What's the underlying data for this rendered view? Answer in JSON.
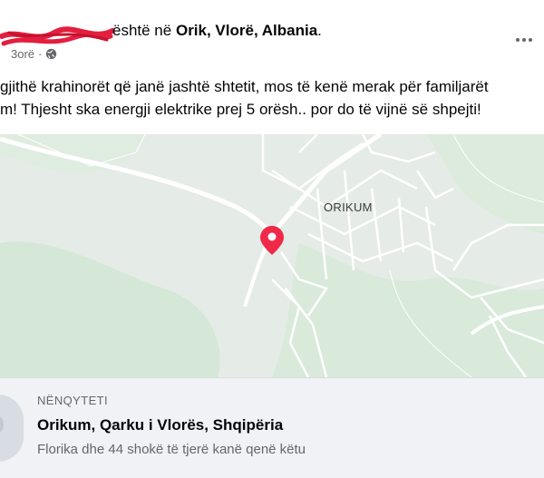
{
  "header": {
    "author": "",
    "checkin_prefix": "është në",
    "location": "Orik, Vlorë, Albania",
    "checkin_suffix": ".",
    "time": "3orë",
    "separator": "·",
    "privacy_icon": "globe-icon",
    "more_icon": "more-dots-icon"
  },
  "post": {
    "line1": "gjithë krahinorët që janë jashtë shtetit, mos të kenë merak për familjarët",
    "line2": "m! Thjesht ska energji elektrike prej 5 orësh.. por do të vijnë së shpejti!"
  },
  "map": {
    "label": "ORIKUM",
    "pin_icon": "map-pin-icon",
    "pin_color": "#f02849",
    "land_color": "#e5ebe6",
    "green_color": "#d5e7d6"
  },
  "place_card": {
    "category": "NËNQYTETI",
    "name": "Orikum, Qarku i Vlorës, Shqipëria",
    "visitors": "Florika dhe 44 shokë të tjerë kanë qenë këtu"
  },
  "colors": {
    "redaction": "#e41e3f",
    "secondary_text": "#65676b",
    "card_bg": "#f0f2f5"
  }
}
